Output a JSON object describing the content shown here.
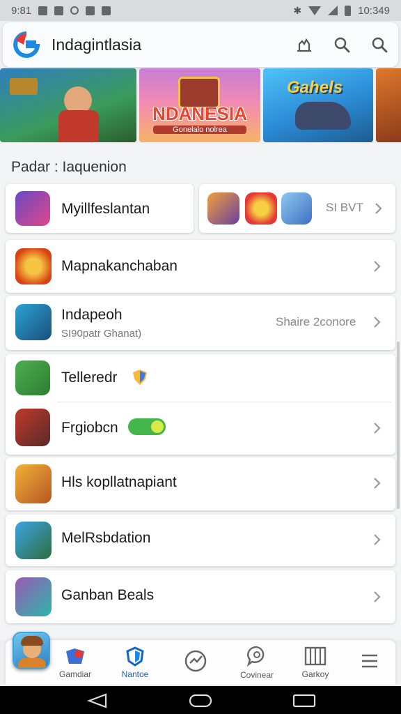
{
  "status_bar": {
    "left_text": "9:81",
    "time": "10:349"
  },
  "app_bar": {
    "search_text": "Indagintlasia"
  },
  "banners": [
    {
      "title": "",
      "subtitle": ""
    },
    {
      "title": "NDANESIA",
      "subtitle": "Gonelalo nolrea"
    },
    {
      "title": "Gahels",
      "subtitle": ""
    },
    {
      "title": "",
      "subtitle": ""
    }
  ],
  "section": {
    "title": "Padar : Iaquenion"
  },
  "rows": [
    {
      "label": "Myillfeslantan"
    },
    {
      "right_text": "SI BVT"
    },
    {
      "label": "Mapnakanchaban"
    },
    {
      "label": "Indapeoh",
      "sub": "SI90patr Ghanat)",
      "right_text": "Shaire 2conore"
    },
    {
      "label": "Telleredr"
    },
    {
      "label": "Frgiobcn"
    },
    {
      "label": "Hls kopllatnapiant"
    },
    {
      "label": "MelRsbdation"
    },
    {
      "label": "Ganban Beals"
    }
  ],
  "bottom_nav": [
    {
      "label": "Gamdiar"
    },
    {
      "label": "Nantoe"
    },
    {
      "label": ""
    },
    {
      "label": "Covinear"
    },
    {
      "label": "Garkoy"
    },
    {
      "label": ""
    }
  ],
  "colors": {
    "accent": "#1565c0",
    "logo_red": "#e53935",
    "logo_blue": "#1e88e5"
  }
}
